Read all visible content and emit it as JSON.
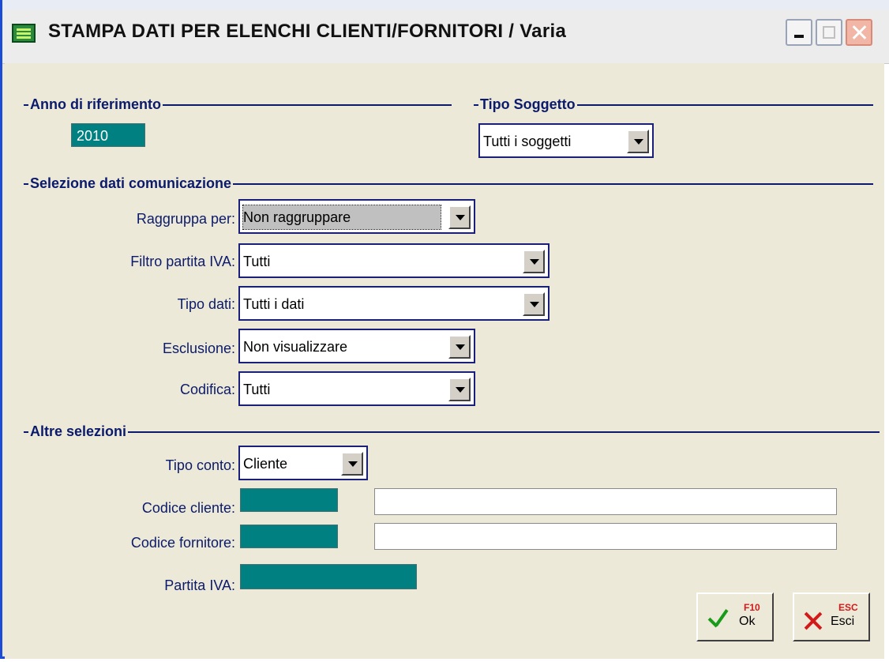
{
  "window": {
    "title": "STAMPA DATI PER ELENCHI CLIENTI/FORNITORI / Varia"
  },
  "anno": {
    "group_label": "Anno di riferimento",
    "value": "2010"
  },
  "tipo_soggetto": {
    "group_label": "Tipo Soggetto",
    "value": "Tutti i soggetti"
  },
  "selezione": {
    "group_label": "Selezione dati comunicazione",
    "raggruppa": {
      "label": "Raggruppa per:",
      "value": "Non raggruppare"
    },
    "filtro_iva": {
      "label": "Filtro partita IVA:",
      "value": "Tutti"
    },
    "tipo_dati": {
      "label": "Tipo dati:",
      "value": "Tutti i dati"
    },
    "esclusione": {
      "label": "Esclusione:",
      "value": "Non visualizzare"
    },
    "codifica": {
      "label": "Codifica:",
      "value": "Tutti"
    }
  },
  "altre": {
    "group_label": "Altre selezioni",
    "tipo_conto": {
      "label": "Tipo conto:",
      "value": "Cliente"
    },
    "codice_cliente": {
      "label": "Codice cliente:",
      "code": "",
      "description": ""
    },
    "codice_fornitore": {
      "label": "Codice fornitore:",
      "code": "",
      "description": ""
    },
    "partita_iva": {
      "label": "Partita IVA:",
      "value": ""
    }
  },
  "buttons": {
    "ok": {
      "label": "Ok",
      "key": "F10"
    },
    "esci": {
      "label": "Esci",
      "key": "ESC"
    }
  },
  "colors": {
    "field_teal": "#008080",
    "label_navy": "#0b1a6b",
    "dialog_bg": "#ece9d8"
  }
}
